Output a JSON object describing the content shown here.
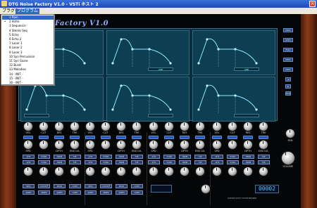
{
  "window": {
    "title": "DTG Noise Factory V1.0 - VSTi ホスト 2",
    "close": "×"
  },
  "menu": {
    "items": [
      "プラグイン",
      "プログラム"
    ],
    "active_index": 1
  },
  "logo": "Factory V1.0",
  "envelope_panels": [
    {
      "label": "AMP"
    },
    {
      "label": "AMP"
    },
    {
      "label": "AMP"
    },
    {
      "label": ""
    },
    {
      "label": ""
    },
    {
      "label": ""
    }
  ],
  "right_buttons": [
    "MOD",
    "MOD",
    "MOD",
    "MOD",
    "MOD"
  ],
  "right_small_buttons": [
    "◄",
    "►",
    "OLD"
  ],
  "knob_row1_labels": [
    "VOL",
    "CUT",
    "RES",
    "TRK"
  ],
  "knob_row2_labels": [
    "SPD",
    "",
    "DPTH",
    "ENV LVL"
  ],
  "small_buttons": [
    "LFO",
    "SYNC",
    "PWM",
    "FLT"
  ],
  "bottom_buttons": [
    "SEQ",
    "CUTOFF",
    "MOD",
    "COPY"
  ],
  "bottom_buttons2": [
    "AMP1",
    "AMP2",
    "AMP3",
    "COPY"
  ],
  "pan_label": "PAN",
  "volume_label": "VOLUME",
  "lcd_left": "",
  "lcd_right": "00002",
  "status_text": "UNDER WITH SYNTHESIZER",
  "program_menu": {
    "items": [
      "1 Rain",
      "2 Alrite",
      "3 Sequence",
      "4 Stereo Seq",
      "5 Echo",
      "6 Echo 2",
      "7 Laser 1",
      "8 Laser 2",
      "9 Laser 3",
      "10 Syn Percussion",
      "11 Syn Snare",
      "12 Burst",
      "13 Melodies",
      "14 - INIT -",
      "15 - INIT -",
      "16 - INIT -"
    ],
    "selected_index": 0,
    "checked_index": 1
  }
}
